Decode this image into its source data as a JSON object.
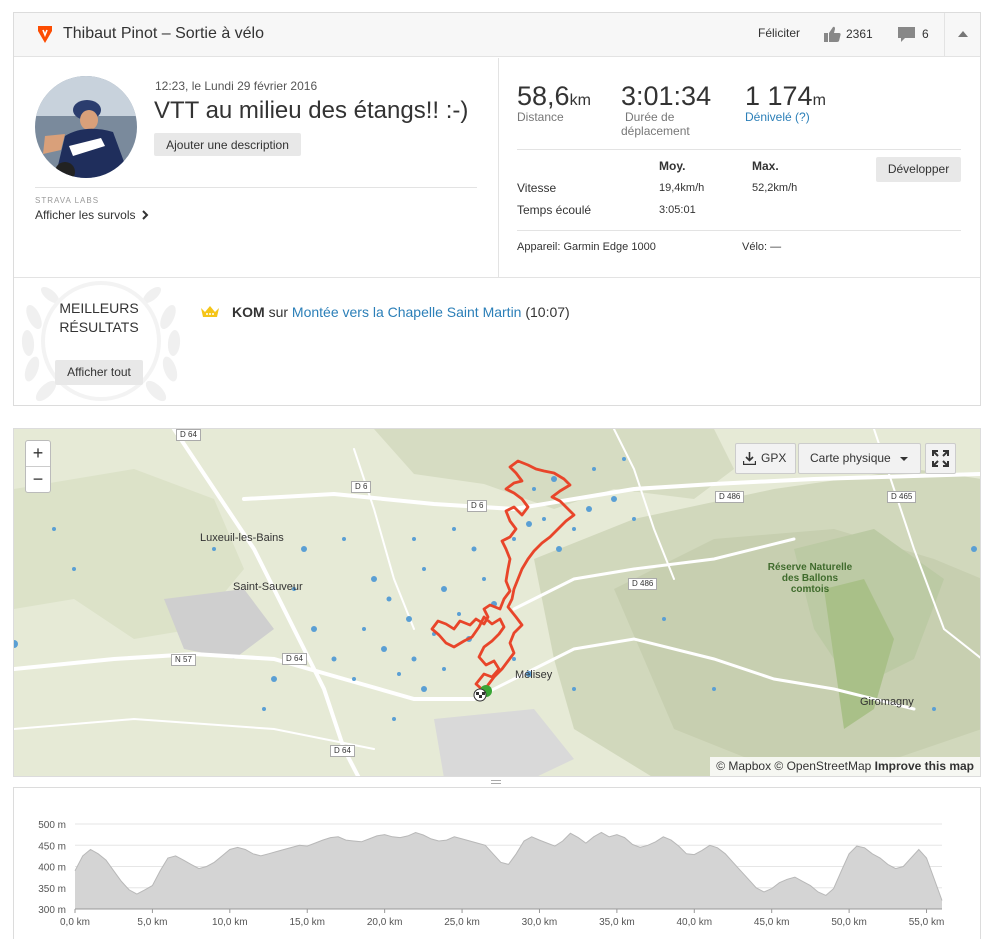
{
  "header": {
    "title": "Thibaut Pinot – Sortie à vélo",
    "congrats_label": "Féliciter",
    "kudos_count": "2361",
    "comment_count": "6"
  },
  "activity": {
    "datetime": "12:23, le Lundi 29 février 2016",
    "title": "VTT au milieu des étangs!! :-)",
    "add_description_label": "Ajouter une description",
    "labs_label": "STRAVA LABS",
    "flyby_label": "Afficher les survols"
  },
  "stats": {
    "distance": {
      "value": "58,6",
      "unit": "km",
      "label": "Distance"
    },
    "moving_time": {
      "value": "3:01:34",
      "label_line1": "Durée de",
      "label_line2": "déplacement"
    },
    "elevation": {
      "value": "1 174",
      "unit": "m",
      "label": "Dénivelé (?)"
    },
    "develop_label": "Développer",
    "table": {
      "col_avg": "Moy.",
      "col_max": "Max.",
      "speed_label": "Vitesse",
      "speed_avg": "19,4km/h",
      "speed_max": "52,2km/h",
      "elapsed_label": "Temps écoulé",
      "elapsed_value": "3:05:01"
    },
    "device": "Appareil: Garmin Edge 1000",
    "bike": "Vélo: —"
  },
  "best_results": {
    "title_line1": "MEILLEURS",
    "title_line2": "RÉSULTATS",
    "show_all_label": "Afficher tout",
    "kom_badge": "KOM",
    "kom_on": "sur",
    "segment_name": "Montée vers la Chapelle Saint Martin",
    "segment_time": "(10:07)"
  },
  "map": {
    "zoom_in": "+",
    "zoom_out": "−",
    "gpx_label": "GPX",
    "map_type_label": "Carte physique",
    "attribution_1": "© Mapbox © OpenStreetMap",
    "attribution_2": "Improve this map",
    "towns": {
      "luxeuil": "Luxeuil-les-Bains",
      "saint_sauveur": "Saint-Sauveur",
      "melisey": "Mélisey",
      "giromagny": "Giromagny"
    },
    "park_line1": "Réserve Naturelle",
    "park_line2": "des Ballons",
    "park_line3": "comtois",
    "roads": {
      "d64_a": "D 64",
      "d6_a": "D 6",
      "d6_b": "D 6",
      "d486_a": "D 486",
      "d486_b": "D 486",
      "d465": "D 465",
      "n57": "N 57",
      "d64_b": "D 64",
      "d64_c": "D 64"
    },
    "colors": {
      "route": "#e8452a",
      "water": "#5a9fd4",
      "land": "#e8ecd8",
      "start": "#3aa635"
    }
  },
  "chart_data": {
    "type": "area",
    "title": "",
    "xlabel": "",
    "ylabel": "",
    "x_unit": "km",
    "y_unit": "m",
    "xlim": [
      0,
      56
    ],
    "ylim": [
      300,
      500
    ],
    "x_ticks": [
      "0,0 km",
      "5,0 km",
      "10,0 km",
      "15,0 km",
      "20,0 km",
      "25,0 km",
      "30,0 km",
      "35,0 km",
      "40,0 km",
      "45,0 km",
      "50,0 km",
      "55,0 km"
    ],
    "y_ticks": [
      "500 m",
      "450 m",
      "400 m",
      "350 m",
      "300 m"
    ],
    "x": [
      0,
      0.5,
      1,
      1.5,
      2,
      2.5,
      3,
      3.5,
      4,
      4.5,
      5,
      5.5,
      6,
      6.5,
      7,
      7.5,
      8,
      8.5,
      9,
      9.5,
      10,
      10.5,
      11,
      11.5,
      12,
      12.5,
      13,
      13.5,
      14,
      14.5,
      15,
      15.5,
      16,
      16.5,
      17,
      17.5,
      18,
      18.5,
      19,
      19.5,
      20,
      20.5,
      21,
      21.5,
      22,
      22.5,
      23,
      23.5,
      24,
      24.5,
      25,
      25.5,
      26,
      26.5,
      27,
      27.5,
      28,
      28.5,
      29,
      29.5,
      30,
      30.5,
      31,
      31.5,
      32,
      32.5,
      33,
      33.5,
      34,
      34.5,
      35,
      35.5,
      36,
      36.5,
      37,
      37.5,
      38,
      38.5,
      39,
      39.5,
      40,
      40.5,
      41,
      41.5,
      42,
      42.5,
      43,
      43.5,
      44,
      44.5,
      45,
      45.5,
      46,
      46.5,
      47,
      47.5,
      48,
      48.5,
      49,
      49.5,
      50,
      50.5,
      51,
      51.5,
      52,
      52.5,
      53,
      53.5,
      54,
      54.5,
      55,
      55.5,
      56
    ],
    "y": [
      390,
      425,
      440,
      430,
      415,
      390,
      365,
      345,
      335,
      345,
      355,
      390,
      420,
      425,
      415,
      405,
      395,
      400,
      410,
      425,
      440,
      445,
      440,
      430,
      425,
      430,
      435,
      440,
      445,
      450,
      448,
      455,
      462,
      468,
      470,
      462,
      460,
      458,
      465,
      472,
      475,
      470,
      468,
      472,
      480,
      474,
      465,
      460,
      462,
      470,
      465,
      460,
      455,
      450,
      430,
      410,
      405,
      430,
      460,
      470,
      462,
      455,
      448,
      460,
      478,
      468,
      455,
      470,
      480,
      470,
      475,
      468,
      452,
      445,
      450,
      458,
      470,
      462,
      448,
      430,
      428,
      438,
      450,
      444,
      430,
      410,
      390,
      370,
      350,
      340,
      348,
      362,
      370,
      375,
      365,
      355,
      340,
      332,
      348,
      390,
      430,
      448,
      444,
      430,
      420,
      405,
      395,
      400,
      420,
      440,
      420,
      370,
      320
    ]
  }
}
